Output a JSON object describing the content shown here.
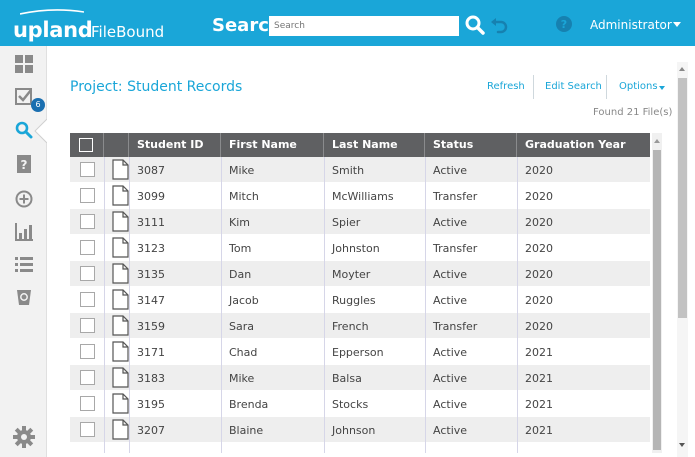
{
  "header": {
    "brand_primary": "upland",
    "brand_secondary": "FileBound",
    "search_label": "Search",
    "search_placeholder": "Search",
    "user_name": "Administrator",
    "bar_color": "#1aa6d8"
  },
  "sidebar": {
    "items": [
      {
        "icon": "dashboard-grid-icon"
      },
      {
        "icon": "tasks-checkbox-icon",
        "badge": "6"
      },
      {
        "icon": "search-icon",
        "active": true
      },
      {
        "icon": "help-document-icon"
      },
      {
        "icon": "add-circle-icon"
      },
      {
        "icon": "reports-chart-icon"
      },
      {
        "icon": "list-icon"
      },
      {
        "icon": "recycle-bin-icon"
      },
      {
        "icon": "settings-gear-icon"
      }
    ]
  },
  "main": {
    "project_title": "Project: Student Records",
    "actions": {
      "refresh": "Refresh",
      "edit_search": "Edit Search",
      "options": "Options"
    },
    "found_count": "Found 21 File(s)",
    "table": {
      "columns": [
        "Student ID",
        "First Name",
        "Last Name",
        "Status",
        "Graduation Year"
      ],
      "rows": [
        [
          "3087",
          "Mike",
          "Smith",
          "Active",
          "2020"
        ],
        [
          "3099",
          "Mitch",
          "McWilliams",
          "Transfer",
          "2020"
        ],
        [
          "3111",
          "Kim",
          "Spier",
          "Active",
          "2020"
        ],
        [
          "3123",
          "Tom",
          "Johnston",
          "Transfer",
          "2020"
        ],
        [
          "3135",
          "Dan",
          "Moyter",
          "Active",
          "2020"
        ],
        [
          "3147",
          "Jacob",
          "Ruggles",
          "Active",
          "2020"
        ],
        [
          "3159",
          "Sara",
          "French",
          "Transfer",
          "2020"
        ],
        [
          "3171",
          "Chad",
          "Epperson",
          "Active",
          "2021"
        ],
        [
          "3183",
          "Mike",
          "Balsa",
          "Active",
          "2021"
        ],
        [
          "3195",
          "Brenda",
          "Stocks",
          "Active",
          "2021"
        ],
        [
          "3207",
          "Blaine",
          "Johnson",
          "Active",
          "2021"
        ]
      ]
    }
  }
}
